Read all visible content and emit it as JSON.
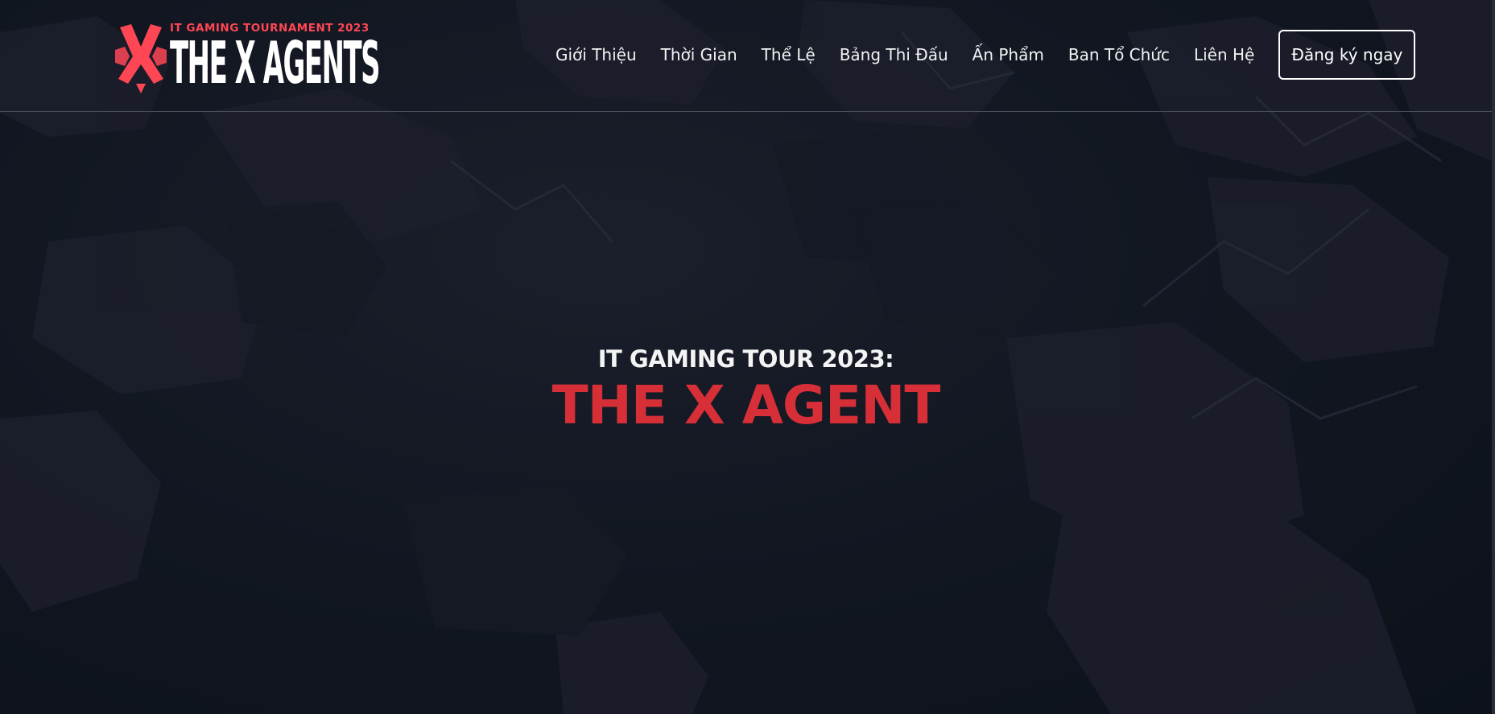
{
  "brand": {
    "kicker": "IT GAMING TOURNAMENT 2023",
    "name": "THE X AGENTS",
    "logo_icon": "x-agents-mark-icon"
  },
  "nav": {
    "items": [
      {
        "label": "Giới Thiệu"
      },
      {
        "label": "Thời Gian"
      },
      {
        "label": "Thể Lệ"
      },
      {
        "label": "Bảng Thi Đấu"
      },
      {
        "label": "Ấn Phẩm"
      },
      {
        "label": "Ban Tổ Chức"
      },
      {
        "label": "Liên Hệ"
      }
    ],
    "cta_label": "Đăng ký ngay"
  },
  "hero": {
    "kicker": "IT GAMING TOUR 2023:",
    "title": "THE X AGENT"
  },
  "colors": {
    "accent": "#d62f38",
    "brand_red": "#ff4655",
    "background": "#0d121c",
    "text": "#ffffff"
  }
}
